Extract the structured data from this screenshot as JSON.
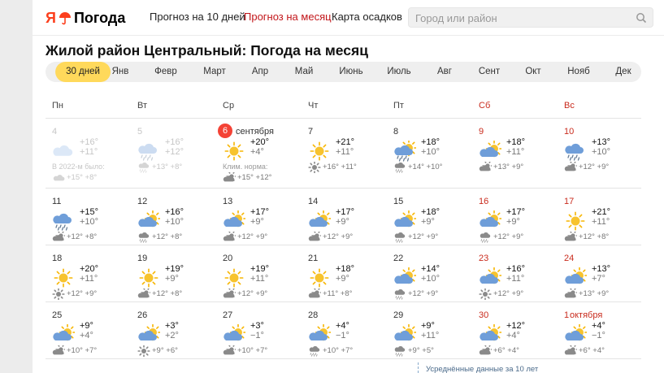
{
  "header": {
    "logo_ya": "Я",
    "logo_text": "Погода",
    "nav": [
      {
        "label": "Прогноз на 10 дней",
        "active": false
      },
      {
        "label": "Прогноз на месяц",
        "active": true
      },
      {
        "label": "Карта осадков",
        "active": false
      }
    ],
    "search_placeholder": "Город или район"
  },
  "title": "Жилой район Центральный: Погода на месяц",
  "months": [
    {
      "label": "30 дней",
      "active": true
    },
    {
      "label": "Янв"
    },
    {
      "label": "Февр"
    },
    {
      "label": "Март"
    },
    {
      "label": "Апр"
    },
    {
      "label": "Май"
    },
    {
      "label": "Июнь"
    },
    {
      "label": "Июль"
    },
    {
      "label": "Авг"
    },
    {
      "label": "Сент"
    },
    {
      "label": "Окт"
    },
    {
      "label": "Нояб"
    },
    {
      "label": "Дек"
    }
  ],
  "weekdays": [
    {
      "label": "Пн",
      "weekend": false
    },
    {
      "label": "Вт",
      "weekend": false
    },
    {
      "label": "Ср",
      "weekend": false
    },
    {
      "label": "Чт",
      "weekend": false
    },
    {
      "label": "Пт",
      "weekend": false
    },
    {
      "label": "Сб",
      "weekend": true
    },
    {
      "label": "Вс",
      "weekend": true
    }
  ],
  "weeks": [
    [
      {
        "date": "4",
        "past": true,
        "icon": "cloudy-icon",
        "day": "+16°",
        "night": "+11°",
        "note": "В 2022-м было:",
        "nicon": "cloudy-icon",
        "nbt": "+15° +8°"
      },
      {
        "date": "5",
        "past": true,
        "icon": "rain-icon",
        "day": "+16°",
        "night": "+12°",
        "nicon": "rain-icon",
        "nbt": "+13° +8°"
      },
      {
        "date": "6",
        "month": "сентября",
        "today": true,
        "icon": "sun-icon",
        "day": "+20°",
        "night": "+4°",
        "note": "Клим. норма:",
        "nicon": "partly-cloudy-icon",
        "nbt": "+15° +12°"
      },
      {
        "date": "7",
        "icon": "sun-icon",
        "day": "+21°",
        "night": "+11°",
        "nicon": "sun-icon",
        "nbt": "+16° +11°"
      },
      {
        "date": "8",
        "icon": "partly-cloudy-rain-icon",
        "day": "+18°",
        "night": "+10°",
        "nicon": "rain-icon",
        "nbt": "+14° +10°"
      },
      {
        "date": "9",
        "weekend": true,
        "icon": "partly-cloudy-icon",
        "day": "+18°",
        "night": "+11°",
        "nicon": "partly-cloudy-icon",
        "nbt": "+13° +9°"
      },
      {
        "date": "10",
        "weekend": true,
        "icon": "rain-icon",
        "day": "+13°",
        "night": "+10°",
        "nicon": "partly-cloudy-icon",
        "nbt": "+12° +9°"
      }
    ],
    [
      {
        "date": "11",
        "icon": "rain-icon",
        "day": "+15°",
        "night": "+10°",
        "nicon": "partly-cloudy-icon",
        "nbt": "+12° +8°"
      },
      {
        "date": "12",
        "icon": "partly-cloudy-icon",
        "day": "+16°",
        "night": "+10°",
        "nicon": "rain-icon",
        "nbt": "+12° +8°"
      },
      {
        "date": "13",
        "icon": "partly-cloudy-icon",
        "day": "+17°",
        "night": "+9°",
        "nicon": "partly-cloudy-icon",
        "nbt": "+12° +9°"
      },
      {
        "date": "14",
        "icon": "partly-cloudy-icon",
        "day": "+17°",
        "night": "+9°",
        "nicon": "partly-cloudy-icon",
        "nbt": "+12° +9°"
      },
      {
        "date": "15",
        "icon": "partly-cloudy-icon",
        "day": "+18°",
        "night": "+9°",
        "nicon": "rain-icon",
        "nbt": "+12° +9°"
      },
      {
        "date": "16",
        "weekend": true,
        "icon": "partly-cloudy-icon",
        "day": "+17°",
        "night": "+9°",
        "nicon": "rain-icon",
        "nbt": "+12° +9°"
      },
      {
        "date": "17",
        "weekend": true,
        "icon": "sun-icon",
        "day": "+21°",
        "night": "+11°",
        "nicon": "partly-cloudy-icon",
        "nbt": "+12° +8°"
      }
    ],
    [
      {
        "date": "18",
        "icon": "sun-icon",
        "day": "+20°",
        "night": "+11°",
        "nicon": "sun-icon",
        "nbt": "+12° +9°"
      },
      {
        "date": "19",
        "icon": "sun-icon",
        "day": "+19°",
        "night": "+9°",
        "nicon": "partly-cloudy-icon",
        "nbt": "+12° +8°"
      },
      {
        "date": "20",
        "icon": "sun-icon",
        "day": "+19°",
        "night": "+11°",
        "nicon": "partly-cloudy-icon",
        "nbt": "+12° +9°"
      },
      {
        "date": "21",
        "icon": "sun-icon",
        "day": "+18°",
        "night": "+9°",
        "nicon": "partly-cloudy-icon",
        "nbt": "+11° +8°"
      },
      {
        "date": "22",
        "icon": "partly-cloudy-icon",
        "day": "+14°",
        "night": "+10°",
        "nicon": "rain-icon",
        "nbt": "+12° +9°"
      },
      {
        "date": "23",
        "weekend": true,
        "icon": "partly-cloudy-icon",
        "day": "+16°",
        "night": "+11°",
        "nicon": "sun-icon",
        "nbt": "+12° +9°"
      },
      {
        "date": "24",
        "weekend": true,
        "icon": "partly-cloudy-icon",
        "day": "+13°",
        "night": "+7°",
        "nicon": "partly-cloudy-icon",
        "nbt": "+13° +9°"
      }
    ],
    [
      {
        "date": "25",
        "icon": "partly-cloudy-icon",
        "day": "+9°",
        "night": "+4°",
        "nicon": "partly-cloudy-icon",
        "nbt": "+10° +7°"
      },
      {
        "date": "26",
        "icon": "partly-cloudy-icon",
        "day": "+3°",
        "night": "+2°",
        "nicon": "sun-icon",
        "nbt": "+9° +6°"
      },
      {
        "date": "27",
        "icon": "partly-cloudy-icon",
        "day": "+3°",
        "night": "−1°",
        "nicon": "partly-cloudy-icon",
        "nbt": "+10° +7°"
      },
      {
        "date": "28",
        "icon": "partly-cloudy-icon",
        "day": "+4°",
        "night": "−1°",
        "nicon": "rain-icon",
        "nbt": "+10° +7°"
      },
      {
        "date": "29",
        "icon": "partly-cloudy-icon",
        "day": "+9°",
        "night": "+11°",
        "nicon": "rain-icon",
        "nbt": "+9° +5°"
      },
      {
        "date": "30",
        "weekend": true,
        "icon": "partly-cloudy-icon",
        "day": "+12°",
        "night": "+4°",
        "nicon": "partly-cloudy-icon",
        "nbt": "+6° +4°"
      },
      {
        "date": "1",
        "month": "октября",
        "weekend": true,
        "icon": "partly-cloudy-icon",
        "day": "+4°",
        "night": "−1°",
        "nicon": "partly-cloudy-icon",
        "nbt": "+6° +4°"
      }
    ]
  ],
  "avg_note": "Усреднённые данные за 10 лет",
  "colors": {
    "accent": "#ffd95b",
    "weekend": "#c92b1d",
    "today": "#f44336"
  }
}
